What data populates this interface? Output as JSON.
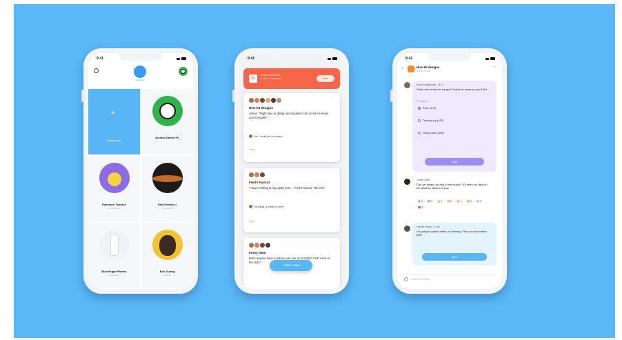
{
  "colors": {
    "background": "#5bb8f8",
    "accent_blue": "#58b6f5",
    "accent_coral": "#f76548",
    "accent_purple": "#9b8ef0"
  },
  "status_bar": {
    "time": "9:41"
  },
  "phone1": {
    "profile_label": "Structure",
    "icons": [
      "gear-icon",
      "avatar",
      "soccer-ball-icon"
    ],
    "tiles": [
      {
        "title": "New group",
        "sub": "",
        "kind": "new"
      },
      {
        "title": "Arsenal United FC",
        "sub": "",
        "kind": "soccer"
      },
      {
        "title": "Pokemon Trainers",
        "sub": "14 members",
        "kind": "pikachu"
      },
      {
        "title": "Fast Friends 4",
        "sub": "7 members",
        "kind": "dark"
      },
      {
        "title": "Blue Bright Photos",
        "sub": "3 members",
        "kind": "bottle"
      },
      {
        "title": "Erin Duong",
        "sub": "Friends",
        "kind": "person"
      }
    ]
  },
  "phone2": {
    "banner": {
      "line1": "Enter a reminder",
      "line2": "or this is not easy",
      "button": "Invite"
    },
    "cards": [
      {
        "title": "Hive kit designs",
        "body": "Aimee: \"Right time to design next season's kit, so let me know your thoughts\" …",
        "note": "Jon: I would just do a quick!",
        "foot": "Reply"
      },
      {
        "title": "Fred's haircut",
        "body": "\"I have nothing to say apart from… Fred's haircut. The end.\"",
        "note": "Fred 😀😀 (3 reactions more)",
        "foot": "Reply"
      },
      {
        "title": "Footy team",
        "body": "Does anyone have a ball we can use on Sunday? I lost mine at the club?",
        "note": "",
        "foot": ""
      }
    ],
    "fab": "+ Start a topic"
  },
  "phone3": {
    "group_name": "Hive kit designs",
    "group_sub": "Arsenal United",
    "poll": {
      "author": "Aimee Hargreaves · 11:22",
      "question": "What new kit should we get? Select as many as you'd like",
      "label": "Poll options",
      "options": [
        "Retro (£75)",
        "Training top (£35)",
        "Playing shirt (£55)"
      ],
      "button": "Vote"
    },
    "reply": {
      "author": "Jordan Smith",
      "text": "Can we please go with a new brand? It's been too tight on the athletes lately this year",
      "reacts": [
        "😀 3",
        "😂 2",
        "👍 1",
        "😍 2",
        "👏 1",
        "🔥 2",
        "😮 1",
        "❤️ 2"
      ]
    },
    "message": {
      "author": "Francis Bowen · 11:45",
      "text": "I'm going to place orders on Monday. Find out now before then.",
      "button": "View"
    },
    "compose_placeholder": "Write a message"
  }
}
